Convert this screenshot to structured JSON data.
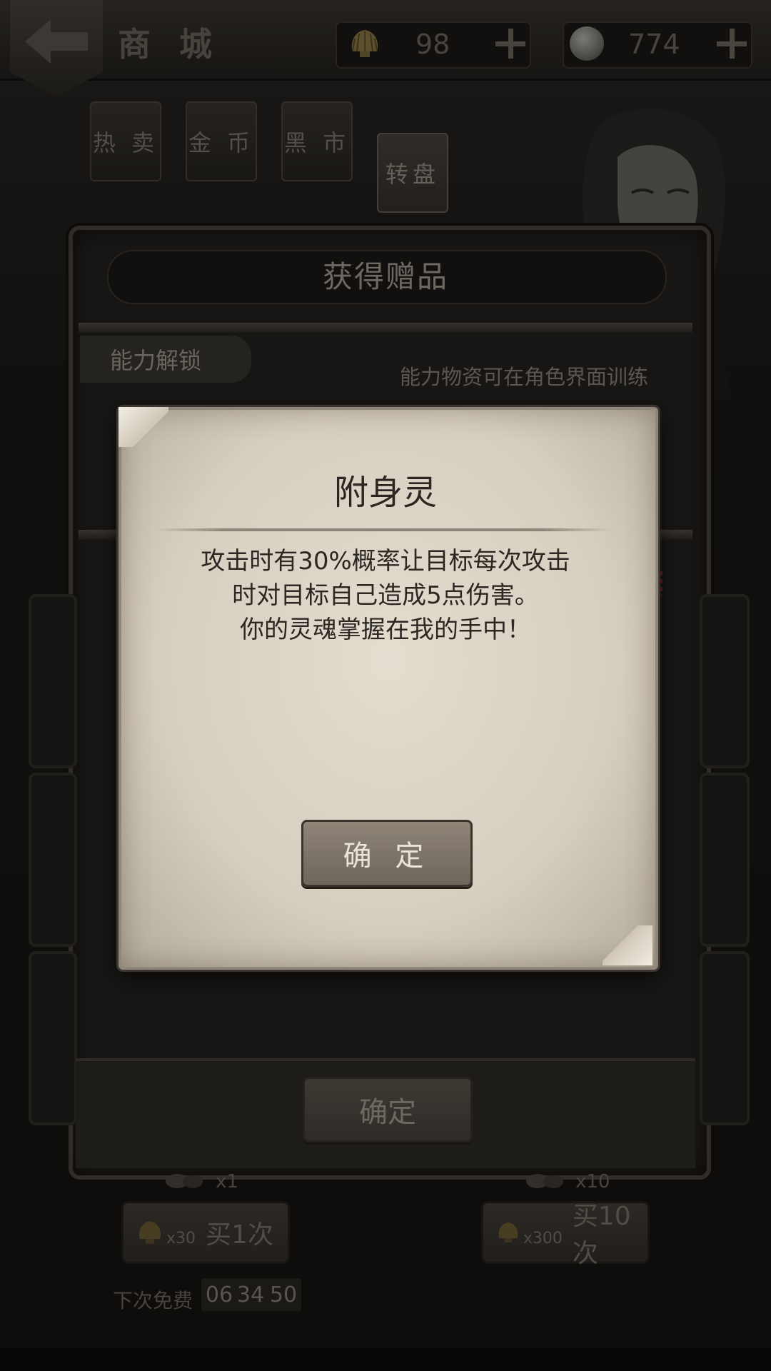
{
  "header": {
    "title": "商 城",
    "shells": "98",
    "silver": "774"
  },
  "tabs": [
    {
      "label": "热 卖"
    },
    {
      "label": "金 币"
    },
    {
      "label": "黑 市"
    },
    {
      "label": "转盘"
    }
  ],
  "gift_panel": {
    "title": "获得赠品",
    "section_tab": "能力解锁",
    "hint": "能力物资可在角色界面训练",
    "confirm_label": "确定"
  },
  "buy": {
    "single": {
      "count": "x1",
      "cost": "x30",
      "label": "买1次"
    },
    "ten": {
      "count": "x10",
      "cost": "x300",
      "label": "买10次"
    },
    "next_free_label": "下次免费",
    "timer_h": "06",
    "timer_m": "34",
    "timer_s": "50"
  },
  "popup": {
    "title": "附身灵",
    "desc_line1": "攻击时有30%概率让目标每次攻击",
    "desc_line2": "时对目标自己造成5点伤害。",
    "desc_line3": "你的灵魂掌握在我的手中！",
    "confirm_label": "确 定"
  },
  "colors": {
    "paper": "#d6cebf",
    "wood_button": "#8e8478",
    "frame": "#4a4540"
  }
}
